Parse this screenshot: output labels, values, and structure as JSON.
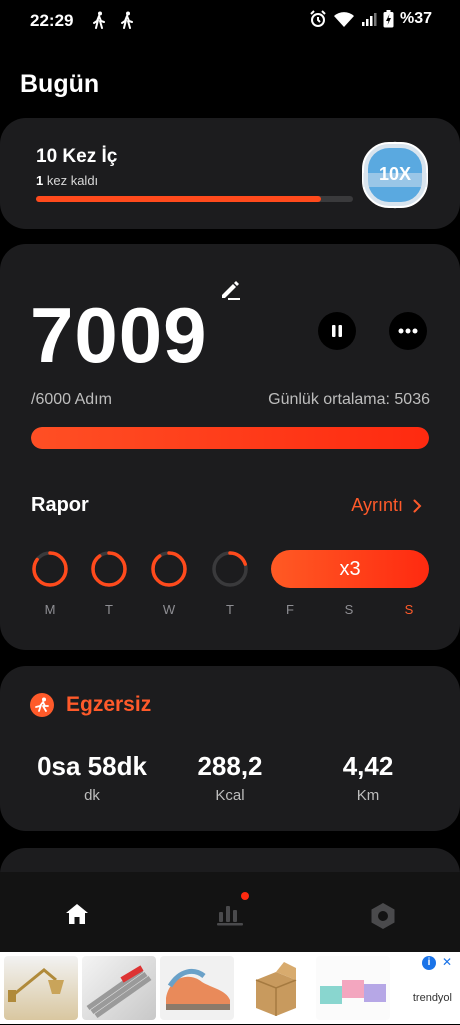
{
  "status_bar": {
    "time": "22:29",
    "battery": "%37"
  },
  "page": {
    "title": "Bugün"
  },
  "challenge": {
    "title": "10 Kez İç",
    "remaining_count": "1",
    "remaining_text": "kez kaldı",
    "progress": 0.9,
    "badge_text": "10X"
  },
  "steps": {
    "count": "7009",
    "goal_text": "/6000 Adım",
    "daily_average": "Günlük ortalama: 5036",
    "progress": 1.0
  },
  "report": {
    "title": "Rapor",
    "details_label": "Ayrıntı",
    "days": [
      {
        "label": "M",
        "progress": 0.85,
        "today": false
      },
      {
        "label": "T",
        "progress": 0.9,
        "today": false
      },
      {
        "label": "W",
        "progress": 0.9,
        "today": false
      },
      {
        "label": "T",
        "progress": 0.2,
        "today": false
      },
      {
        "label": "F",
        "progress": 1.0,
        "today": false
      },
      {
        "label": "S",
        "progress": 1.0,
        "today": false
      },
      {
        "label": "S",
        "progress": 1.0,
        "today": true
      }
    ],
    "streak_label": "x3"
  },
  "exercise": {
    "title": "Egzersiz",
    "metrics": [
      {
        "value": "0sa 58dk",
        "unit": "dk"
      },
      {
        "value": "288,2",
        "unit": "Kcal"
      },
      {
        "value": "4,42",
        "unit": "Km"
      }
    ]
  },
  "bottom_nav": {
    "items": [
      "home-icon",
      "stats-icon",
      "settings-icon"
    ],
    "active": "home-icon"
  },
  "ad": {
    "brand": "trendyol"
  },
  "colors": {
    "accent": "#ff5a2a",
    "card": "#1c1c1e",
    "track": "#3a3a3c"
  },
  "icons": [
    "walking-person-icon",
    "alarm-icon",
    "wifi-icon",
    "signal-icon",
    "battery-icon",
    "edit-icon",
    "pause-icon",
    "more-icon",
    "chevron-right-icon",
    "running-icon"
  ]
}
